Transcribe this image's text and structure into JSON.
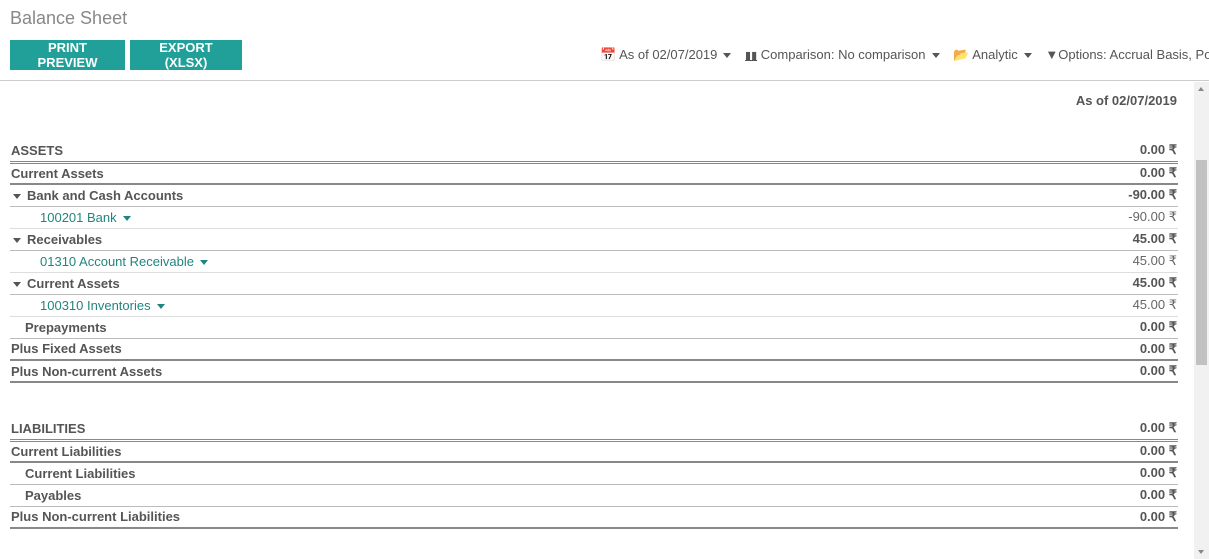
{
  "page": {
    "title": "Balance Sheet"
  },
  "toolbar": {
    "print_label": "PRINT PREVIEW",
    "export_label": "EXPORT (XLSX)"
  },
  "filters": {
    "date": "As of 02/07/2019",
    "comparison": "Comparison: No comparison",
    "analytic": "Analytic",
    "options": "Options: Accrual Basis, Pos"
  },
  "report": {
    "column_header": "As of 02/07/2019",
    "assets": [
      {
        "name": "ASSETS",
        "amount": "0.00 ₹"
      },
      {
        "name": "Current Assets",
        "amount": "0.00 ₹"
      },
      {
        "name": "Bank and Cash Accounts",
        "amount": "-90.00 ₹"
      },
      {
        "name": "100201 Bank",
        "amount": "-90.00 ₹"
      },
      {
        "name": "Receivables",
        "amount": "45.00 ₹"
      },
      {
        "name": "01310 Account Receivable",
        "amount": "45.00 ₹"
      },
      {
        "name": "Current Assets",
        "amount": "45.00 ₹"
      },
      {
        "name": "100310 Inventories",
        "amount": "45.00 ₹"
      },
      {
        "name": "Prepayments",
        "amount": "0.00 ₹"
      },
      {
        "name": "Plus Fixed Assets",
        "amount": "0.00 ₹"
      },
      {
        "name": "Plus Non-current Assets",
        "amount": "0.00 ₹"
      }
    ],
    "liabilities": [
      {
        "name": "LIABILITIES",
        "amount": "0.00 ₹"
      },
      {
        "name": "Current Liabilities",
        "amount": "0.00 ₹"
      },
      {
        "name": "Current Liabilities",
        "amount": "0.00 ₹"
      },
      {
        "name": "Payables",
        "amount": "0.00 ₹"
      },
      {
        "name": "Plus Non-current Liabilities",
        "amount": "0.00 ₹"
      }
    ]
  }
}
